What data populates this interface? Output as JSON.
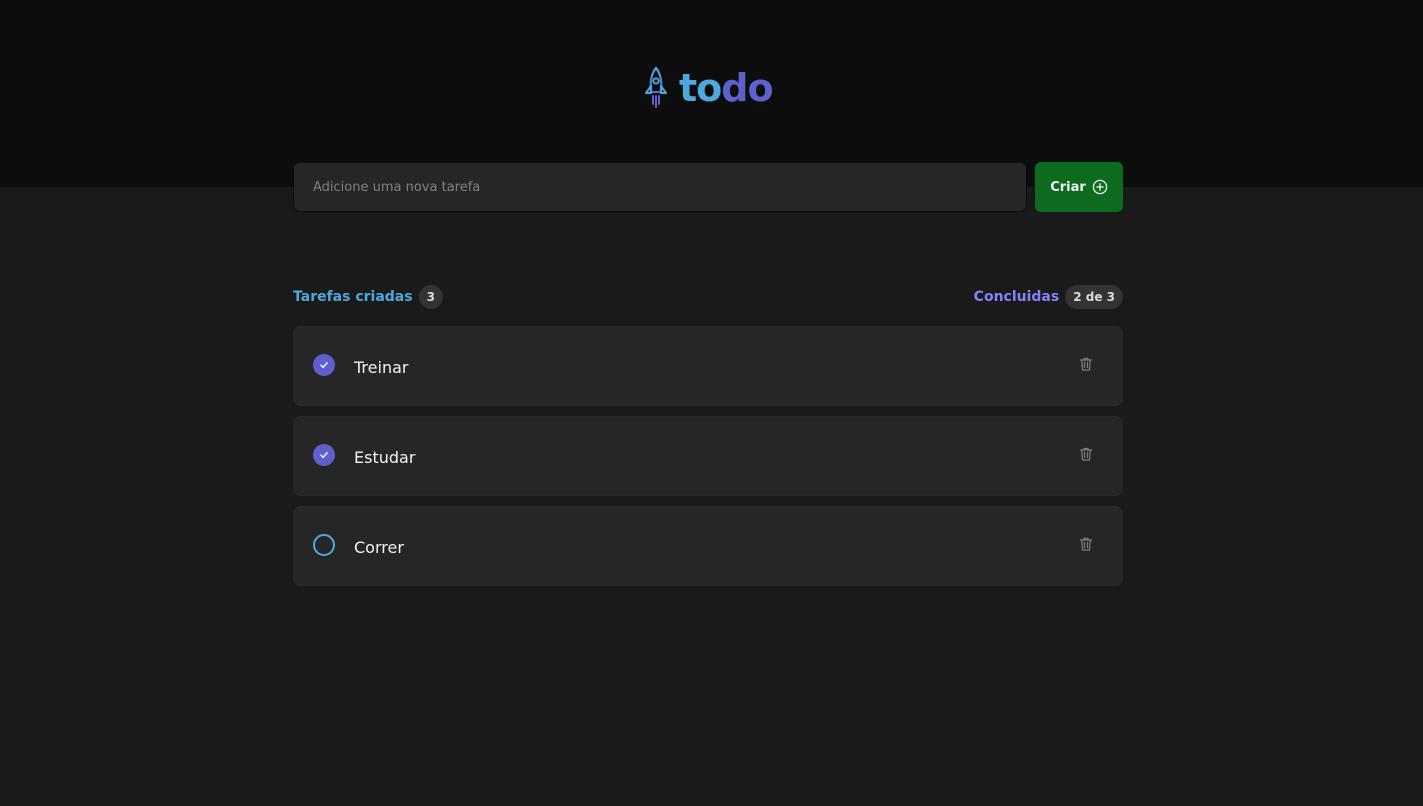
{
  "header": {
    "logo_icon": "rocket-icon",
    "logo_text_part1": "to",
    "logo_text_part2": "do",
    "colors": {
      "blue": "#4ea8de",
      "purple": "#5e60ce"
    }
  },
  "new_task": {
    "placeholder": "Adicione uma nova tarefa",
    "value": "",
    "create_label": "Criar",
    "create_icon": "plus-circle-icon",
    "button_color": "#0d6b1e"
  },
  "counters": {
    "created_label": "Tarefas criadas",
    "created_count": "3",
    "done_label": "Concluidas",
    "done_count": "2 de 3"
  },
  "tasks": [
    {
      "text": "Treinar",
      "done": true,
      "check_icon": "check-icon",
      "delete_icon": "trash-icon"
    },
    {
      "text": "Estudar",
      "done": true,
      "check_icon": "check-icon",
      "delete_icon": "trash-icon"
    },
    {
      "text": "Correr",
      "done": false,
      "check_icon": "empty-circle-icon",
      "delete_icon": "trash-icon"
    }
  ]
}
